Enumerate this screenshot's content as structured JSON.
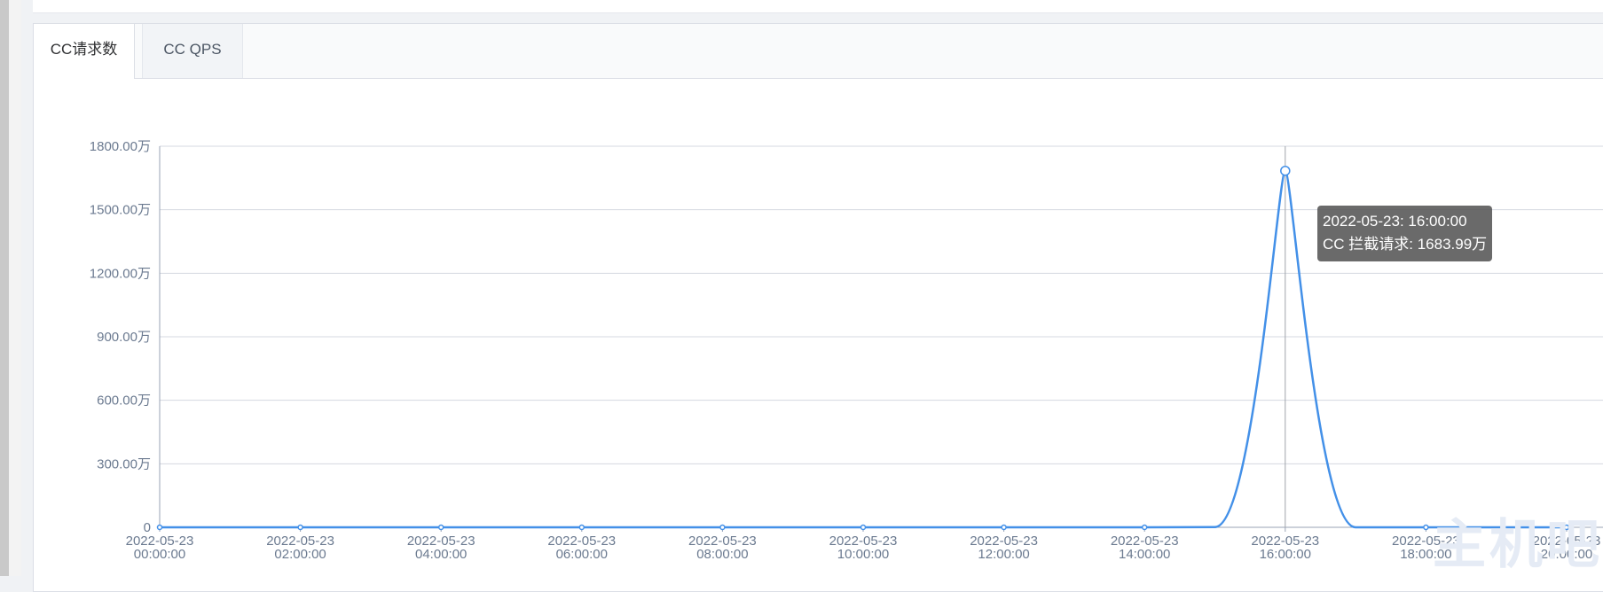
{
  "tabs": [
    {
      "label": "CC请求数",
      "active": true
    },
    {
      "label": "CC QPS",
      "active": false
    }
  ],
  "tooltip": {
    "line1": "2022-05-23: 16:00:00",
    "line2": "CC 拦截请求: 1683.99万"
  },
  "watermark": "主机吧",
  "colors": {
    "series": "#4390e8",
    "axis": "#9aa3b5",
    "tick_text": "#6b7a90",
    "grid": "#d4d8e0",
    "crosshair": "#a0a4aa"
  },
  "chart_data": {
    "type": "line",
    "y_unit": "万",
    "ylim": [
      0,
      1800
    ],
    "y_ticks": [
      0,
      300,
      600,
      900,
      1200,
      1500,
      1800
    ],
    "y_tick_labels": [
      "0",
      "300.00万",
      "600.00万",
      "900.00万",
      "1200.00万",
      "1500.00万",
      "1800.00万"
    ],
    "x_tick_labels": [
      [
        "2022-05-23",
        "00:00:00"
      ],
      [
        "2022-05-23",
        "02:00:00"
      ],
      [
        "2022-05-23",
        "04:00:00"
      ],
      [
        "2022-05-23",
        "06:00:00"
      ],
      [
        "2022-05-23",
        "08:00:00"
      ],
      [
        "2022-05-23",
        "10:00:00"
      ],
      [
        "2022-05-23",
        "12:00:00"
      ],
      [
        "2022-05-23",
        "14:00:00"
      ],
      [
        "2022-05-23",
        "16:00:00"
      ],
      [
        "2022-05-23",
        "18:00:00"
      ],
      [
        "2022-05-23",
        "20:00:00"
      ]
    ],
    "grid": true,
    "series": [
      {
        "name": "CC 拦截请求",
        "x": [
          "2022-05-23 00:00:00",
          "2022-05-23 01:00:00",
          "2022-05-23 02:00:00",
          "2022-05-23 03:00:00",
          "2022-05-23 04:00:00",
          "2022-05-23 05:00:00",
          "2022-05-23 06:00:00",
          "2022-05-23 07:00:00",
          "2022-05-23 08:00:00",
          "2022-05-23 09:00:00",
          "2022-05-23 10:00:00",
          "2022-05-23 11:00:00",
          "2022-05-23 12:00:00",
          "2022-05-23 13:00:00",
          "2022-05-23 14:00:00",
          "2022-05-23 15:00:00",
          "2022-05-23 16:00:00",
          "2022-05-23 17:00:00",
          "2022-05-23 18:00:00",
          "2022-05-23 19:00:00",
          "2022-05-23 20:00:00"
        ],
        "values": [
          0,
          0,
          0,
          0,
          0,
          0,
          0,
          0,
          0,
          0,
          0,
          0,
          0,
          0,
          0,
          1,
          1683.99,
          0,
          0,
          0,
          0
        ]
      }
    ],
    "highlight_index": 16
  }
}
